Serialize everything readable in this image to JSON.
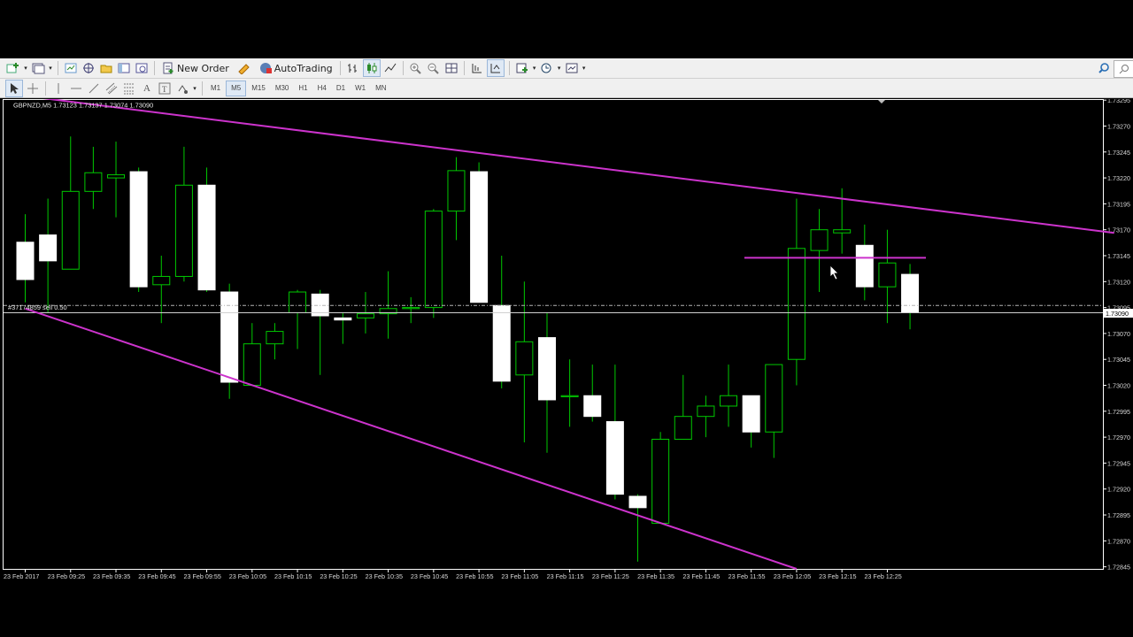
{
  "toolbar": {
    "new_order_label": "New Order",
    "autotrading_label": "AutoTrading",
    "timeframes": [
      "M1",
      "M5",
      "M15",
      "M30",
      "H1",
      "H4",
      "D1",
      "W1",
      "MN"
    ],
    "active_timeframe": "M5"
  },
  "chart": {
    "header": "GBPNZD,M5  1.73123 1.73137 1.73074 1.73090",
    "order_label": "#37174859 sell 0.50",
    "current_price": "1.73090"
  },
  "colors": {
    "background": "#000000",
    "bull_candle": "#000000",
    "bear_candle": "#ffffff",
    "wick": "#00c800",
    "trendline": "#cc33cc",
    "grid_dash": "#b4b4b4"
  },
  "chart_data": {
    "type": "candlestick",
    "symbol": "GBPNZD",
    "timeframe": "M5",
    "y_ticks": [
      "1.73295",
      "1.73270",
      "1.73245",
      "1.73220",
      "1.73195",
      "1.73170",
      "1.73145",
      "1.73120",
      "1.73095",
      "1.73070",
      "1.73045",
      "1.73020",
      "1.72995",
      "1.72970",
      "1.72945",
      "1.72920",
      "1.72895",
      "1.72870",
      "1.72845"
    ],
    "ylim": [
      1.72843,
      1.73296
    ],
    "x_ticks": [
      "23 Feb 2017",
      "23 Feb 09:25",
      "23 Feb 09:35",
      "23 Feb 09:45",
      "23 Feb 09:55",
      "23 Feb 10:05",
      "23 Feb 10:15",
      "23 Feb 10:25",
      "23 Feb 10:35",
      "23 Feb 10:45",
      "23 Feb 10:55",
      "23 Feb 11:05",
      "23 Feb 11:15",
      "23 Feb 11:25",
      "23 Feb 11:35",
      "23 Feb 11:45",
      "23 Feb 11:55",
      "23 Feb 12:05",
      "23 Feb 12:15",
      "23 Feb 12:25"
    ],
    "candles": [
      {
        "o": 1.73158,
        "h": 1.73185,
        "l": 1.731,
        "c": 1.73122
      },
      {
        "o": 1.73165,
        "h": 1.732,
        "l": 1.7309,
        "c": 1.7314
      },
      {
        "o": 1.73132,
        "h": 1.7326,
        "l": 1.73135,
        "c": 1.73207
      },
      {
        "o": 1.73207,
        "h": 1.7325,
        "l": 1.7319,
        "c": 1.73225
      },
      {
        "o": 1.7322,
        "h": 1.73255,
        "l": 1.73182,
        "c": 1.73223
      },
      {
        "o": 1.73226,
        "h": 1.7323,
        "l": 1.7311,
        "c": 1.73115
      },
      {
        "o": 1.73117,
        "h": 1.73145,
        "l": 1.7308,
        "c": 1.73125
      },
      {
        "o": 1.73125,
        "h": 1.7325,
        "l": 1.7312,
        "c": 1.73213
      },
      {
        "o": 1.73213,
        "h": 1.7323,
        "l": 1.7311,
        "c": 1.73112
      },
      {
        "o": 1.7311,
        "h": 1.73118,
        "l": 1.73007,
        "c": 1.73023
      },
      {
        "o": 1.7302,
        "h": 1.7308,
        "l": 1.7302,
        "c": 1.7306
      },
      {
        "o": 1.7306,
        "h": 1.7308,
        "l": 1.73045,
        "c": 1.73072
      },
      {
        "o": 1.7309,
        "h": 1.73112,
        "l": 1.73055,
        "c": 1.7311
      },
      {
        "o": 1.73108,
        "h": 1.73112,
        "l": 1.7303,
        "c": 1.73087
      },
      {
        "o": 1.73085,
        "h": 1.7309,
        "l": 1.7306,
        "c": 1.73083
      },
      {
        "o": 1.73085,
        "h": 1.7311,
        "l": 1.7307,
        "c": 1.73089
      },
      {
        "o": 1.73089,
        "h": 1.7313,
        "l": 1.73065,
        "c": 1.73094
      },
      {
        "o": 1.73094,
        "h": 1.73105,
        "l": 1.7308,
        "c": 1.73095
      },
      {
        "o": 1.73095,
        "h": 1.7319,
        "l": 1.73085,
        "c": 1.73188
      },
      {
        "o": 1.73188,
        "h": 1.7324,
        "l": 1.7316,
        "c": 1.73227
      },
      {
        "o": 1.73226,
        "h": 1.73235,
        "l": 1.731,
        "c": 1.731
      },
      {
        "o": 1.73097,
        "h": 1.73145,
        "l": 1.73017,
        "c": 1.73024
      },
      {
        "o": 1.7303,
        "h": 1.7312,
        "l": 1.72965,
        "c": 1.73062
      },
      {
        "o": 1.73066,
        "h": 1.7309,
        "l": 1.72955,
        "c": 1.73006
      },
      {
        "o": 1.7301,
        "h": 1.73045,
        "l": 1.7298,
        "c": 1.7301
      },
      {
        "o": 1.7301,
        "h": 1.7304,
        "l": 1.72985,
        "c": 1.7299
      },
      {
        "o": 1.72985,
        "h": 1.7304,
        "l": 1.7291,
        "c": 1.72915
      },
      {
        "o": 1.72913,
        "h": 1.72915,
        "l": 1.7285,
        "c": 1.72902
      },
      {
        "o": 1.72887,
        "h": 1.72975,
        "l": 1.7289,
        "c": 1.72968
      },
      {
        "o": 1.72968,
        "h": 1.7303,
        "l": 1.7297,
        "c": 1.7299
      },
      {
        "o": 1.7299,
        "h": 1.7301,
        "l": 1.7297,
        "c": 1.73
      },
      {
        "o": 1.73,
        "h": 1.7304,
        "l": 1.7298,
        "c": 1.7301
      },
      {
        "o": 1.7301,
        "h": 1.7301,
        "l": 1.7296,
        "c": 1.72975
      },
      {
        "o": 1.72975,
        "h": 1.7304,
        "l": 1.7295,
        "c": 1.7304
      },
      {
        "o": 1.73045,
        "h": 1.732,
        "l": 1.7302,
        "c": 1.73152
      },
      {
        "o": 1.7315,
        "h": 1.7319,
        "l": 1.7311,
        "c": 1.7317
      },
      {
        "o": 1.73167,
        "h": 1.7321,
        "l": 1.73147,
        "c": 1.7317
      },
      {
        "o": 1.73155,
        "h": 1.73175,
        "l": 1.73102,
        "c": 1.73115
      },
      {
        "o": 1.73115,
        "h": 1.7317,
        "l": 1.7308,
        "c": 1.73138
      },
      {
        "o": 1.73127,
        "h": 1.73137,
        "l": 1.73074,
        "c": 1.7309
      }
    ],
    "trendlines": [
      {
        "name": "upper-channel",
        "t1": 0,
        "p1": 1.73299,
        "t2": 48,
        "p2": 1.73167
      },
      {
        "name": "lower-channel",
        "t1": 0,
        "p1": 1.73094,
        "t2": 34,
        "p2": 1.72843
      },
      {
        "name": "resistance-short",
        "t1": 31.7,
        "p1": 1.73143,
        "t2": 39.7,
        "p2": 1.73143
      }
    ],
    "order_level": 1.73097
  }
}
